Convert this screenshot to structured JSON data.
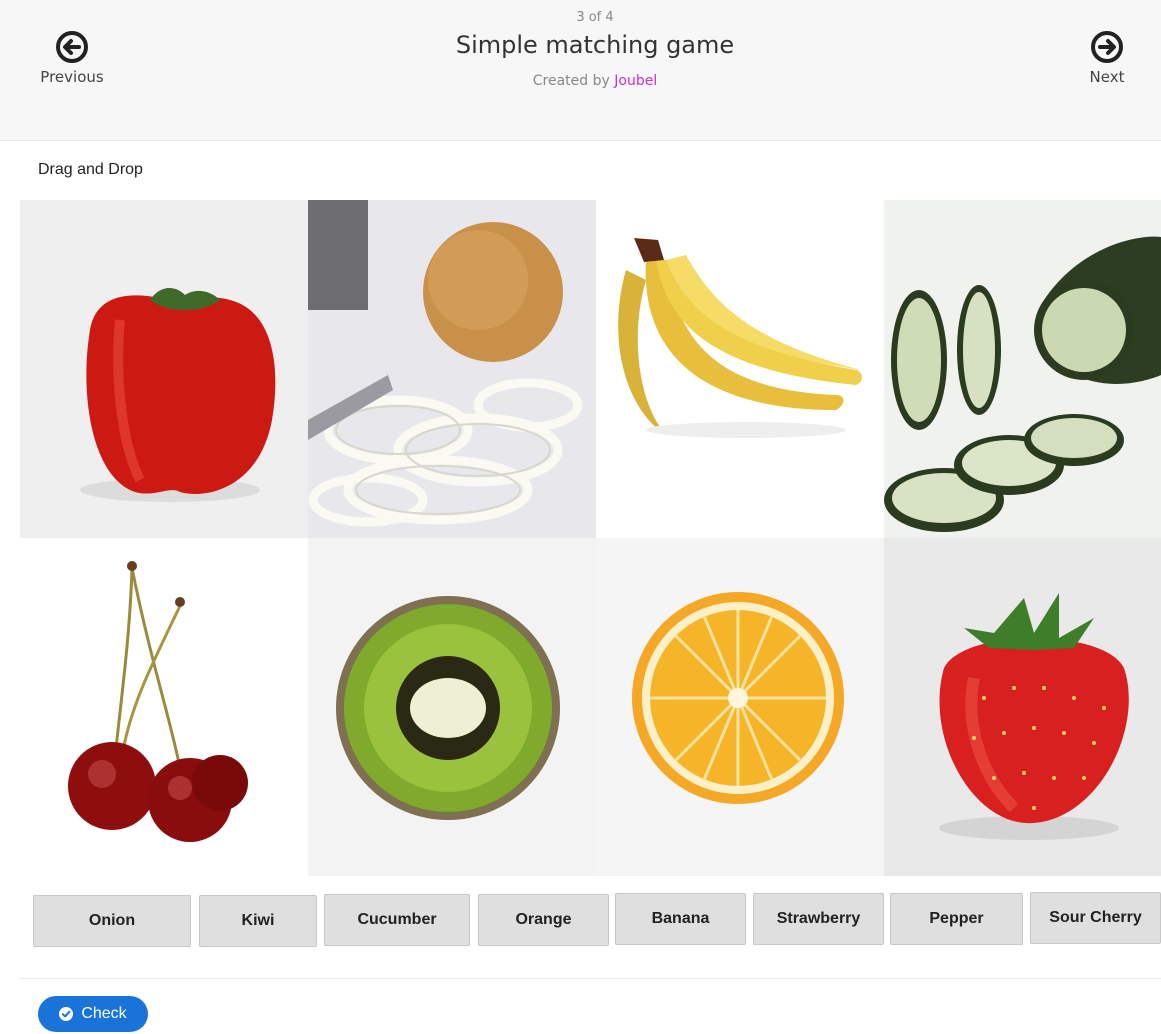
{
  "header": {
    "counter": "3 of 4",
    "title": "Simple matching game",
    "created_by_prefix": "Created by ",
    "author": "Joubel",
    "previous_label": "Previous",
    "next_label": "Next"
  },
  "task": {
    "label": "Drag and Drop"
  },
  "tiles": [
    {
      "name": "pepper-image"
    },
    {
      "name": "onion-image"
    },
    {
      "name": "banana-image"
    },
    {
      "name": "cucumber-image"
    },
    {
      "name": "sour-cherry-image"
    },
    {
      "name": "kiwi-image"
    },
    {
      "name": "orange-image"
    },
    {
      "name": "strawberry-image"
    }
  ],
  "words": [
    "Onion",
    "Kiwi",
    "Cucumber",
    "Orange",
    "Banana",
    "Strawberry",
    "Pepper",
    "Sour Cherry"
  ],
  "check": {
    "label": "Check",
    "icon": "check-circle-icon"
  },
  "colors": {
    "accent": "#1a73d9",
    "author_link": "#d12dd1"
  }
}
